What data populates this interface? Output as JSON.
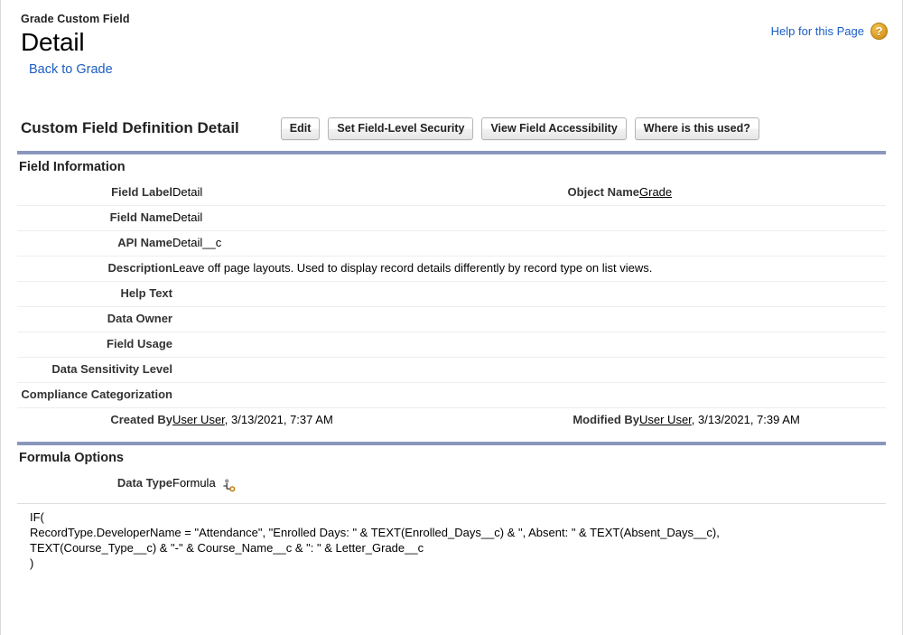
{
  "header": {
    "eyebrow": "Grade Custom Field",
    "title": "Detail",
    "back_link": "Back to Grade",
    "help_link": "Help for this Page",
    "help_icon_glyph": "?",
    "help_icon_name": "help-question-icon"
  },
  "detail_bar": {
    "title": "Custom Field Definition Detail",
    "buttons": [
      {
        "label": "Edit",
        "name": "edit-button"
      },
      {
        "label": "Set Field-Level Security",
        "name": "set-field-level-security-button"
      },
      {
        "label": "View Field Accessibility",
        "name": "view-field-accessibility-button"
      },
      {
        "label": "Where is this used?",
        "name": "where-is-this-used-button"
      }
    ]
  },
  "field_information": {
    "section_title": "Field Information",
    "rows": [
      {
        "label": "Field Label",
        "value": "Detail",
        "right_label": "Object Name",
        "right_value": "Grade",
        "right_is_link": true
      },
      {
        "label": "Field Name",
        "value": "Detail",
        "right_label": "",
        "right_value": ""
      },
      {
        "label": "API Name",
        "value": "Detail__c",
        "right_label": "",
        "right_value": ""
      },
      {
        "label": "Description",
        "value": "Leave off page layouts. Used to display record details differently by record type on list views.",
        "right_label": "",
        "right_value": "",
        "full_width": true
      },
      {
        "label": "Help Text",
        "value": "",
        "right_label": "",
        "right_value": ""
      },
      {
        "label": "Data Owner",
        "value": "",
        "right_label": "",
        "right_value": ""
      },
      {
        "label": "Field Usage",
        "value": "",
        "right_label": "",
        "right_value": ""
      },
      {
        "label": "Data Sensitivity Level",
        "value": "",
        "right_label": "",
        "right_value": ""
      },
      {
        "label": "Compliance Categorization",
        "value": "",
        "right_label": "",
        "right_value": ""
      },
      {
        "label": "Created By",
        "value_link": "User User",
        "value_rest": ", 3/13/2021, 7:37 AM",
        "right_label": "Modified By",
        "right_value_link": "User User",
        "right_value_rest": ", 3/13/2021, 7:39 AM",
        "is_audit": true
      }
    ]
  },
  "formula_options": {
    "section_title": "Formula Options",
    "data_type_label": "Data Type",
    "data_type_value": "Formula",
    "data_type_icon_name": "formula-field-icon",
    "formula_text": "IF(\nRecordType.DeveloperName = \"Attendance\", \"Enrolled Days: \" & TEXT(Enrolled_Days__c) & \", Absent: \" & TEXT(Absent_Days__c),\nTEXT(Course_Type__c) & \"-\" & Course_Name__c & \": \" & Letter_Grade__c\n)"
  },
  "colors": {
    "section_rule": "#8a97bd",
    "link": "#1c5dc4",
    "help_icon": "#e0a12a",
    "row_separator": "#eeeeee"
  }
}
